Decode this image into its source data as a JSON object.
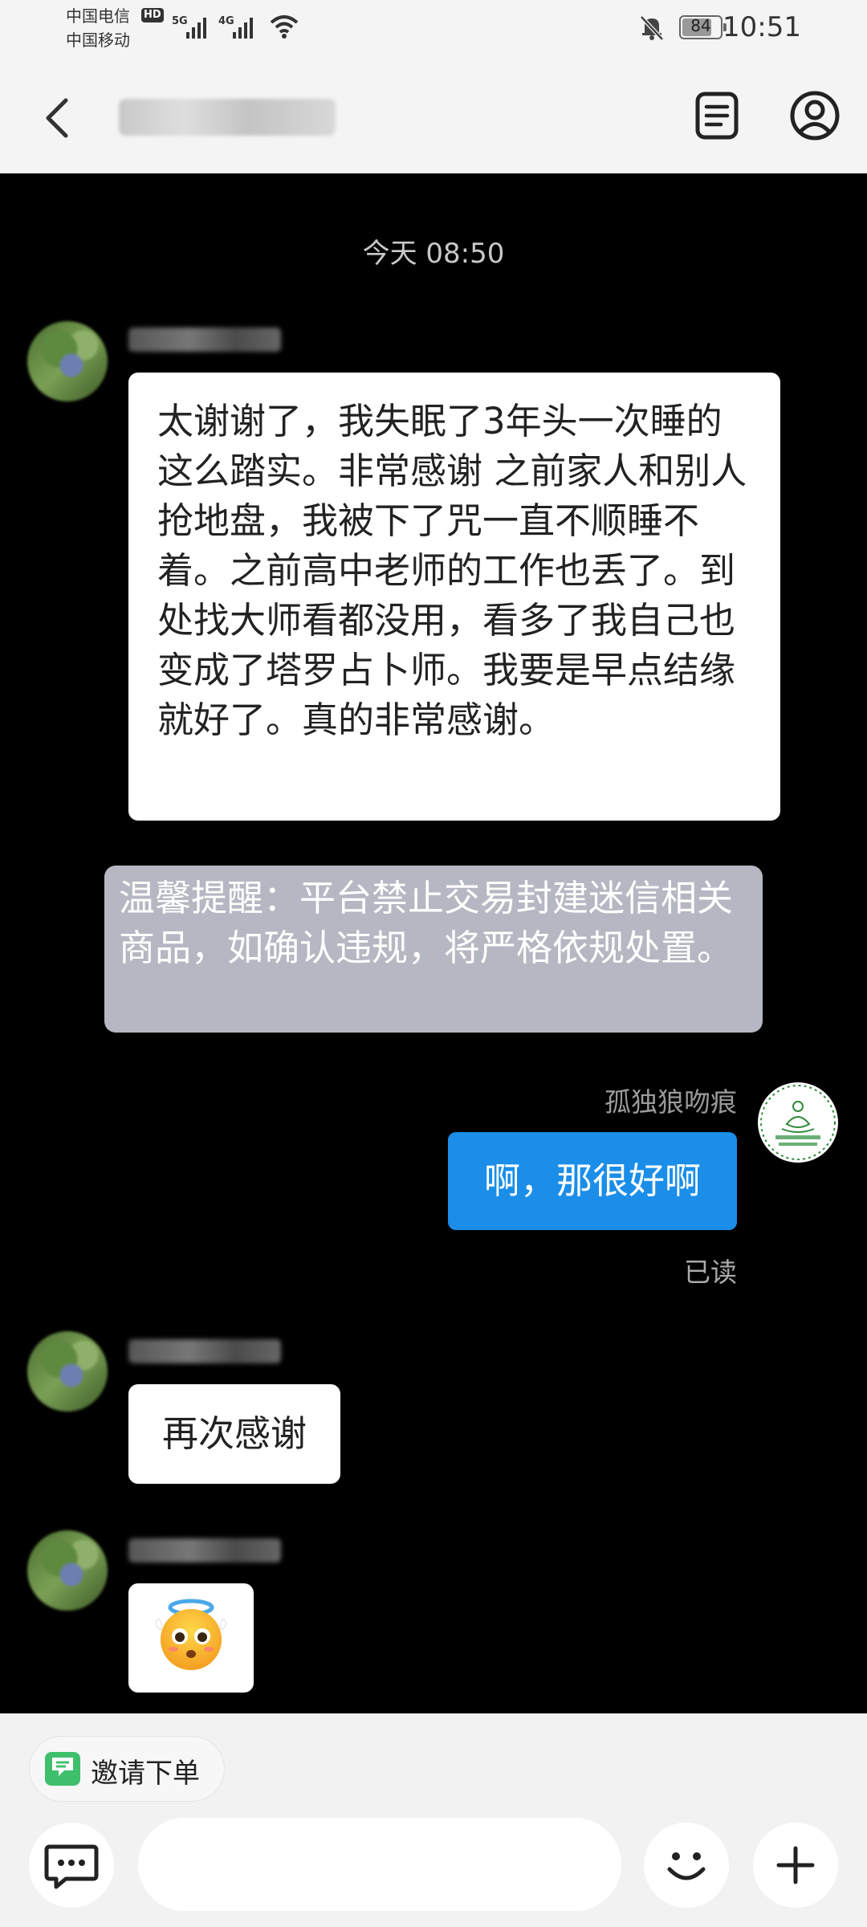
{
  "status_bar": {
    "carrier1": "中国电信",
    "carrier2": "中国移动",
    "hd_badge": "HD",
    "net1": "5G",
    "net2": "4G",
    "battery": "84",
    "time": "10:51"
  },
  "header": {
    "title": "tb_7219258"
  },
  "chat": {
    "timestamp": "今天  08:50",
    "other_nick": "tb_7219258",
    "msg1": "太谢谢了，我失眠了3年头一次睡的这么踏实。非常感谢 之前家人和别人抢地盘，我被下了咒一直不顺睡不着。之前高中老师的工作也丢了。到处找大师看都没用，看多了我自己也变成了塔罗占卜师。我要是早点结缘就好了。真的非常感谢。",
    "notice": "温馨提醒：平台禁止交易封建迷信相关商品，如确认违规，将严格依规处置。",
    "my_nick": "孤独狼吻痕",
    "my_msg": "啊，那很好啊",
    "read_status": "已读",
    "msg2": "再次感谢",
    "msg3_icon": "angel-face-emoji"
  },
  "bottom": {
    "chip_label": "邀请下单",
    "input_value": ""
  },
  "colors": {
    "accent_blue": "#1a8ee8",
    "notice_bg": "#b5b7c2",
    "chat_bg": "#000000"
  }
}
